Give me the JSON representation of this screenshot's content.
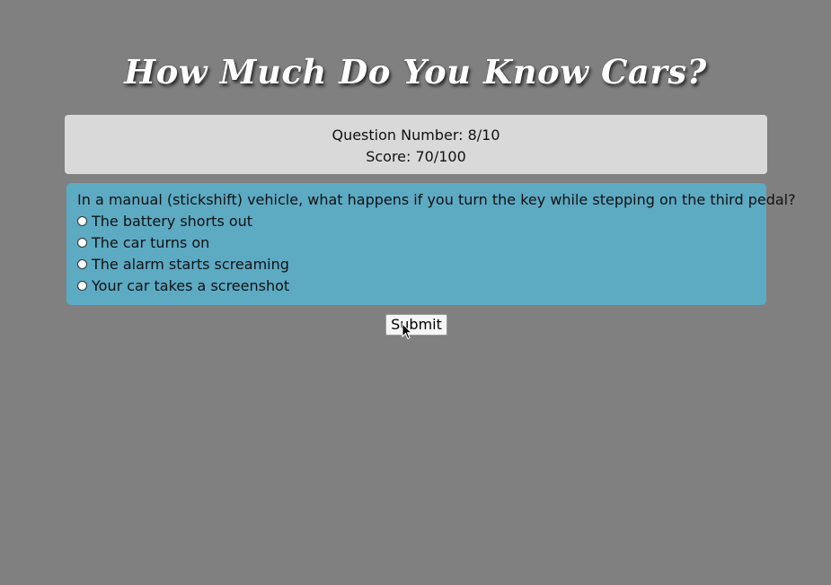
{
  "header": {
    "title": "How Much Do You Know Cars?"
  },
  "status": {
    "question_number": "Question Number: 8/10",
    "score": "Score: 70/100"
  },
  "quiz": {
    "question": "In a manual (stickshift) vehicle, what happens if you turn the key while stepping on the third pedal?",
    "options": [
      {
        "label": "The battery shorts out",
        "selected": false
      },
      {
        "label": "The car turns on",
        "selected": false
      },
      {
        "label": "The alarm starts screaming",
        "selected": false
      },
      {
        "label": "Your car takes a screenshot",
        "selected": false
      }
    ]
  },
  "actions": {
    "submit_label": "Submit"
  },
  "colors": {
    "page_background": "#808080",
    "status_panel": "#d9d9d9",
    "question_panel": "#5daac3",
    "title_text": "#ffffff"
  }
}
